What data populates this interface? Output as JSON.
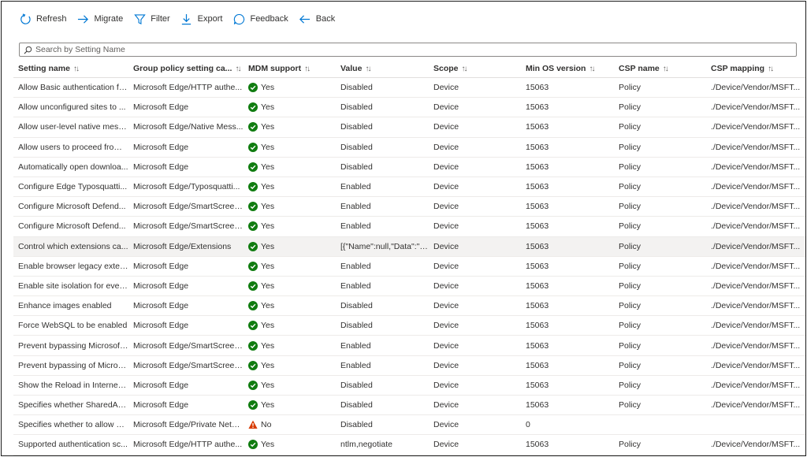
{
  "toolbar": {
    "refresh": "Refresh",
    "migrate": "Migrate",
    "filter": "Filter",
    "export": "Export",
    "feedback": "Feedback",
    "back": "Back"
  },
  "search": {
    "placeholder": "Search by Setting Name"
  },
  "colors": {
    "accent": "#0078d4",
    "success": "#107c10",
    "warning": "#d83b01"
  },
  "columns": [
    "Setting name",
    "Group policy setting ca...",
    "MDM support",
    "Value",
    "Scope",
    "Min OS version",
    "CSP name",
    "CSP mapping"
  ],
  "rows": [
    {
      "name": "Allow Basic authentication fo...",
      "category": "Microsoft Edge/HTTP authe...",
      "mdm": "Yes",
      "mdm_status": "success",
      "value": "Disabled",
      "scope": "Device",
      "min_os": "15063",
      "csp_name": "Policy",
      "csp_mapping": "./Device/Vendor/MSFT..."
    },
    {
      "name": "Allow unconfigured sites to ...",
      "category": "Microsoft Edge",
      "mdm": "Yes",
      "mdm_status": "success",
      "value": "Disabled",
      "scope": "Device",
      "min_os": "15063",
      "csp_name": "Policy",
      "csp_mapping": "./Device/Vendor/MSFT..."
    },
    {
      "name": "Allow user-level native mess...",
      "category": "Microsoft Edge/Native Mess...",
      "mdm": "Yes",
      "mdm_status": "success",
      "value": "Disabled",
      "scope": "Device",
      "min_os": "15063",
      "csp_name": "Policy",
      "csp_mapping": "./Device/Vendor/MSFT..."
    },
    {
      "name": "Allow users to proceed from ...",
      "category": "Microsoft Edge",
      "mdm": "Yes",
      "mdm_status": "success",
      "value": "Disabled",
      "scope": "Device",
      "min_os": "15063",
      "csp_name": "Policy",
      "csp_mapping": "./Device/Vendor/MSFT..."
    },
    {
      "name": "Automatically open downloa...",
      "category": "Microsoft Edge",
      "mdm": "Yes",
      "mdm_status": "success",
      "value": "Disabled",
      "scope": "Device",
      "min_os": "15063",
      "csp_name": "Policy",
      "csp_mapping": "./Device/Vendor/MSFT..."
    },
    {
      "name": "Configure Edge Typosquatti...",
      "category": "Microsoft Edge/Typosquatti...",
      "mdm": "Yes",
      "mdm_status": "success",
      "value": "Enabled",
      "scope": "Device",
      "min_os": "15063",
      "csp_name": "Policy",
      "csp_mapping": "./Device/Vendor/MSFT..."
    },
    {
      "name": "Configure Microsoft Defend...",
      "category": "Microsoft Edge/SmartScreen...",
      "mdm": "Yes",
      "mdm_status": "success",
      "value": "Enabled",
      "scope": "Device",
      "min_os": "15063",
      "csp_name": "Policy",
      "csp_mapping": "./Device/Vendor/MSFT..."
    },
    {
      "name": "Configure Microsoft Defend...",
      "category": "Microsoft Edge/SmartScreen...",
      "mdm": "Yes",
      "mdm_status": "success",
      "value": "Enabled",
      "scope": "Device",
      "min_os": "15063",
      "csp_name": "Policy",
      "csp_mapping": "./Device/Vendor/MSFT..."
    },
    {
      "name": "Control which extensions ca...",
      "category": "Microsoft Edge/Extensions",
      "mdm": "Yes",
      "mdm_status": "success",
      "value": "[{\"Name\":null,\"Data\":\"*...",
      "scope": "Device",
      "min_os": "15063",
      "csp_name": "Policy",
      "csp_mapping": "./Device/Vendor/MSFT...",
      "selected": true
    },
    {
      "name": "Enable browser legacy exten...",
      "category": "Microsoft Edge",
      "mdm": "Yes",
      "mdm_status": "success",
      "value": "Enabled",
      "scope": "Device",
      "min_os": "15063",
      "csp_name": "Policy",
      "csp_mapping": "./Device/Vendor/MSFT..."
    },
    {
      "name": "Enable site isolation for ever...",
      "category": "Microsoft Edge",
      "mdm": "Yes",
      "mdm_status": "success",
      "value": "Enabled",
      "scope": "Device",
      "min_os": "15063",
      "csp_name": "Policy",
      "csp_mapping": "./Device/Vendor/MSFT..."
    },
    {
      "name": "Enhance images enabled",
      "category": "Microsoft Edge",
      "mdm": "Yes",
      "mdm_status": "success",
      "value": "Disabled",
      "scope": "Device",
      "min_os": "15063",
      "csp_name": "Policy",
      "csp_mapping": "./Device/Vendor/MSFT..."
    },
    {
      "name": "Force WebSQL to be enabled",
      "category": "Microsoft Edge",
      "mdm": "Yes",
      "mdm_status": "success",
      "value": "Disabled",
      "scope": "Device",
      "min_os": "15063",
      "csp_name": "Policy",
      "csp_mapping": "./Device/Vendor/MSFT..."
    },
    {
      "name": "Prevent bypassing Microsoft ...",
      "category": "Microsoft Edge/SmartScreen...",
      "mdm": "Yes",
      "mdm_status": "success",
      "value": "Enabled",
      "scope": "Device",
      "min_os": "15063",
      "csp_name": "Policy",
      "csp_mapping": "./Device/Vendor/MSFT..."
    },
    {
      "name": "Prevent bypassing of Micros...",
      "category": "Microsoft Edge/SmartScreen...",
      "mdm": "Yes",
      "mdm_status": "success",
      "value": "Enabled",
      "scope": "Device",
      "min_os": "15063",
      "csp_name": "Policy",
      "csp_mapping": "./Device/Vendor/MSFT..."
    },
    {
      "name": "Show the Reload in Internet ...",
      "category": "Microsoft Edge",
      "mdm": "Yes",
      "mdm_status": "success",
      "value": "Disabled",
      "scope": "Device",
      "min_os": "15063",
      "csp_name": "Policy",
      "csp_mapping": "./Device/Vendor/MSFT..."
    },
    {
      "name": "Specifies whether SharedArr...",
      "category": "Microsoft Edge",
      "mdm": "Yes",
      "mdm_status": "success",
      "value": "Disabled",
      "scope": "Device",
      "min_os": "15063",
      "csp_name": "Policy",
      "csp_mapping": "./Device/Vendor/MSFT..."
    },
    {
      "name": "Specifies whether to allow w...",
      "category": "Microsoft Edge/Private Netw...",
      "mdm": "No",
      "mdm_status": "warning",
      "value": "Disabled",
      "scope": "Device",
      "min_os": "0",
      "csp_name": "",
      "csp_mapping": ""
    },
    {
      "name": "Supported authentication sc...",
      "category": "Microsoft Edge/HTTP authe...",
      "mdm": "Yes",
      "mdm_status": "success",
      "value": "ntlm,negotiate",
      "scope": "Device",
      "min_os": "15063",
      "csp_name": "Policy",
      "csp_mapping": "./Device/Vendor/MSFT..."
    }
  ]
}
